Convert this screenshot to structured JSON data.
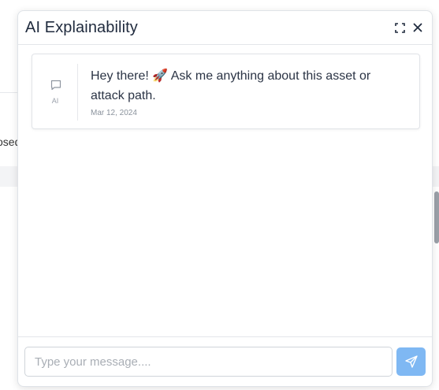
{
  "background": {
    "partial_text": "osed"
  },
  "panel": {
    "title": "AI Explainability",
    "expand_icon": "expand-icon",
    "close_icon": "close-icon"
  },
  "message": {
    "sender_icon": "chat-bubble-icon",
    "sender_label": "AI",
    "text": "Hey there! 🚀 Ask me anything about this asset or attack path.",
    "date": "Mar 12, 2024"
  },
  "composer": {
    "placeholder": "Type your message....",
    "value": "",
    "send_icon": "send-icon",
    "send_color": "#7fb8f3"
  }
}
